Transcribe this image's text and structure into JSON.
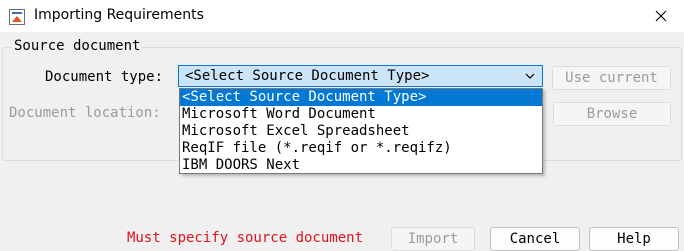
{
  "window": {
    "title": "Importing Requirements",
    "app_icon": "matlab-app-icon",
    "close_icon": "close-icon"
  },
  "source_group": {
    "legend": "Source document",
    "document_type_label": "Document type:",
    "document_location_label": "Document location:",
    "document_type_value": "<Select Source Document Type>",
    "use_current_label": "Use current",
    "browse_label": "Browse",
    "dropdown_options": [
      "<Select Source Document Type>",
      "Microsoft Word Document",
      "Microsoft Excel Spreadsheet",
      "ReqIF file (*.reqif or *.reqifz)",
      "IBM DOORS Next"
    ],
    "selected_option_index": 0
  },
  "footer": {
    "error_message": "Must specify source document",
    "import_label": "Import",
    "cancel_label": "Cancel",
    "help_label": "Help"
  },
  "colors": {
    "error": "#e0131b",
    "selection": "#0078d4",
    "combo_focus_bg": "#cce4f7",
    "disabled_text": "#9b9b9b"
  }
}
